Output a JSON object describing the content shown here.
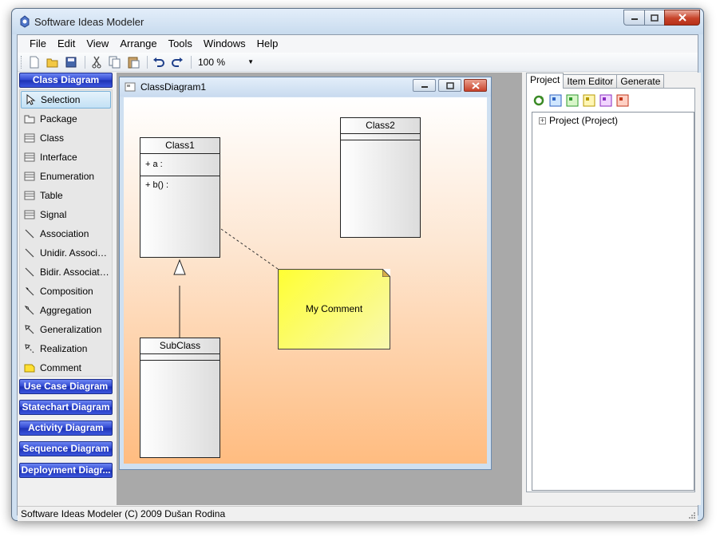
{
  "window": {
    "title": "Software Ideas Modeler"
  },
  "menu": [
    "File",
    "Edit",
    "View",
    "Arrange",
    "Tools",
    "Windows",
    "Help"
  ],
  "toolbar": {
    "icons": [
      "new-icon",
      "open-icon",
      "save-icon",
      "cut-icon",
      "copy-icon",
      "paste-icon",
      "undo-icon",
      "redo-icon"
    ],
    "zoom": "100 %"
  },
  "toolbox": {
    "active_group": "Class Diagram",
    "tools": [
      {
        "label": "Selection",
        "icon": "pointer-icon"
      },
      {
        "label": "Package",
        "icon": "package-icon"
      },
      {
        "label": "Class",
        "icon": "class-icon"
      },
      {
        "label": "Interface",
        "icon": "interface-icon"
      },
      {
        "label": "Enumeration",
        "icon": "enumeration-icon"
      },
      {
        "label": "Table",
        "icon": "table-icon"
      },
      {
        "label": "Signal",
        "icon": "signal-icon"
      },
      {
        "label": "Association",
        "icon": "association-icon"
      },
      {
        "label": "Unidir. Associati...",
        "icon": "unidir-association-icon"
      },
      {
        "label": "Bidir. Association",
        "icon": "bidir-association-icon"
      },
      {
        "label": "Composition",
        "icon": "composition-icon"
      },
      {
        "label": "Aggregation",
        "icon": "aggregation-icon"
      },
      {
        "label": "Generalization",
        "icon": "generalization-icon"
      },
      {
        "label": "Realization",
        "icon": "realization-icon"
      },
      {
        "label": "Comment",
        "icon": "comment-icon"
      }
    ],
    "groups": [
      "Use Case Diagram",
      "Statechart Diagram",
      "Activity Diagram",
      "Sequence Diagram",
      "Deployment Diagr..."
    ]
  },
  "document": {
    "title": "ClassDiagram1",
    "class1": {
      "name": "Class1",
      "attribute": "+ a :",
      "operation": "+ b() :"
    },
    "class2": {
      "name": "Class2"
    },
    "subclass": {
      "name": "SubClass"
    },
    "comment": "My Comment"
  },
  "right_panel": {
    "tabs": [
      "Project",
      "Item Editor",
      "Generate"
    ],
    "tree_root": "Project (Project)",
    "expander": "+"
  },
  "status": "Software Ideas Modeler (C) 2009 Dušan Rodina",
  "colors": {
    "accent": "#2d45d0",
    "note": "#ffff33",
    "canvas_bottom": "#ffbc80"
  }
}
